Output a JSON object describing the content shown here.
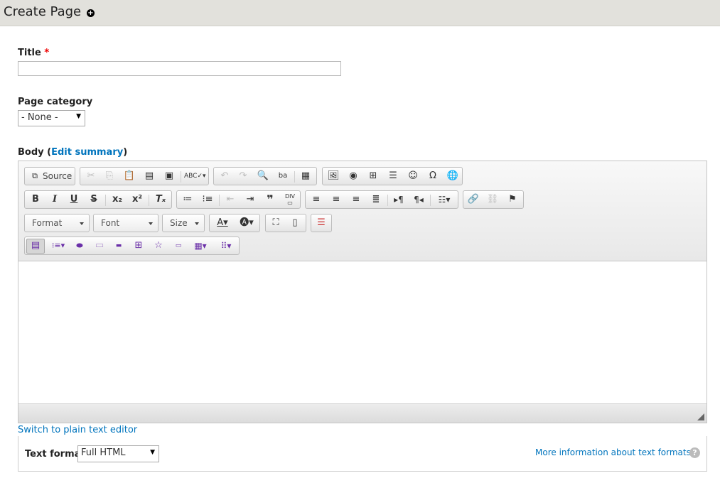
{
  "header": {
    "title": "Create Page",
    "shortcut_icon": "plus-circle-icon"
  },
  "form": {
    "title_label": "Title",
    "required_mark": "*",
    "title_value": "",
    "category_label": "Page category",
    "category_value": "- None -",
    "body_label": "Body (",
    "edit_summary_link": "Edit summary",
    "body_label_close": ")",
    "switch_editor_link": "Switch to plain text editor",
    "text_format_label": "Text format",
    "text_format_value": "Full HTML",
    "more_info_link": "More information about text formats",
    "help_icon_text": "?"
  },
  "toolbar": {
    "source_label": "Source",
    "format_label": "Format",
    "font_label": "Font",
    "size_label": "Size",
    "icons": {
      "source": "source-icon",
      "cut": "cut-icon",
      "copy": "copy-icon",
      "paste": "paste-icon",
      "paste_text": "paste-text-icon",
      "paste_word": "paste-from-word-icon",
      "spellcheck": "spellcheck-icon",
      "undo": "undo-icon",
      "redo": "redo-icon",
      "find": "find-icon",
      "replace": "replace-icon",
      "select_all": "select-all-icon",
      "image": "image-icon",
      "flash": "flash-icon",
      "table": "table-icon",
      "hr": "horizontal-rule-icon",
      "smiley": "smiley-icon",
      "special_char": "special-character-icon",
      "iframe": "iframe-icon",
      "bold": "bold-icon",
      "italic": "italic-icon",
      "underline": "underline-icon",
      "strike": "strikethrough-icon",
      "subscript": "subscript-icon",
      "superscript": "superscript-icon",
      "remove_format": "remove-format-icon",
      "numbered_list": "numbered-list-icon",
      "bulleted_list": "bulleted-list-icon",
      "outdent": "outdent-icon",
      "indent": "indent-icon",
      "blockquote": "blockquote-icon",
      "div": "div-container-icon",
      "align_left": "align-left-icon",
      "align_center": "align-center-icon",
      "align_right": "align-right-icon",
      "justify": "justify-icon",
      "ltr": "text-direction-ltr-icon",
      "rtl": "text-direction-rtl-icon",
      "language": "language-icon",
      "link": "link-icon",
      "unlink": "unlink-icon",
      "anchor": "anchor-icon",
      "text_color": "text-color-icon",
      "bg_color": "background-color-icon",
      "maximize": "maximize-icon",
      "show_blocks": "show-blocks-icon",
      "page_break": "page-break-icon"
    },
    "colors": {
      "disabled": "#bdbdbd",
      "purple": "#6a2fa8",
      "link": "#0074bd",
      "required": "#ee0000"
    }
  }
}
